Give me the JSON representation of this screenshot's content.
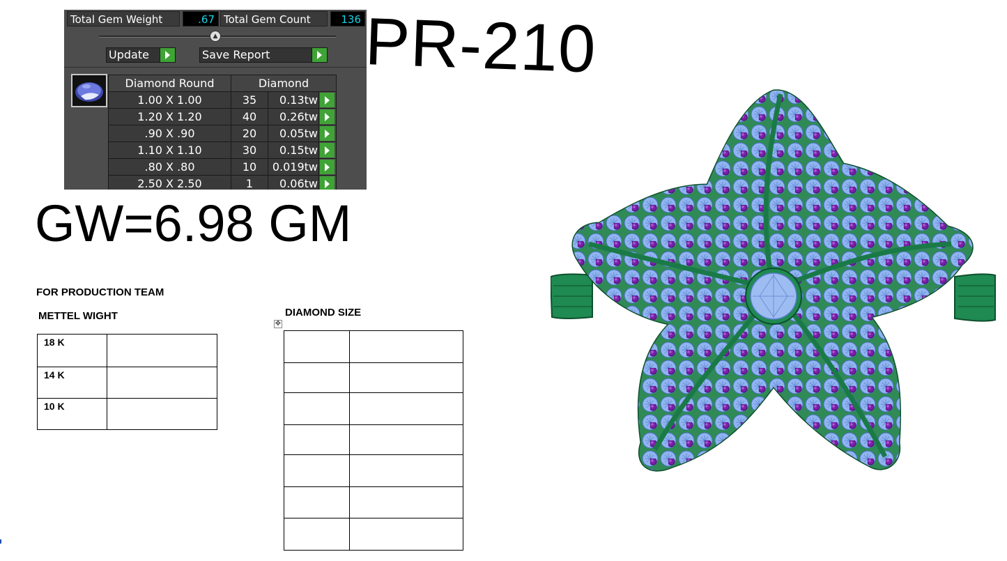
{
  "panel": {
    "total_gem_weight_label": "Total Gem Weight",
    "total_gem_weight_value": ".67",
    "total_gem_count_label": "Total Gem Count",
    "total_gem_count_value": "136",
    "update_label": "Update",
    "save_report_label": "Save Report",
    "columns": [
      "Diamond Round",
      "Diamond"
    ],
    "rows": [
      {
        "size": "1.00 X 1.00",
        "count": "35",
        "tw": "0.13tw"
      },
      {
        "size": "1.20 X 1.20",
        "count": "40",
        "tw": "0.26tw"
      },
      {
        "size": ".90 X .90",
        "count": "20",
        "tw": "0.05tw"
      },
      {
        "size": "1.10 X 1.10",
        "count": "30",
        "tw": "0.15tw"
      },
      {
        "size": ".80 X .80",
        "count": "10",
        "tw": "0.019tw"
      },
      {
        "size": "2.50 X 2.50",
        "count": "1",
        "tw": "0.06tw"
      }
    ]
  },
  "product_code": "PR-210",
  "gross_weight": "GW=6.98 GM",
  "production": {
    "heading": "FOR PRODUCTION TEAM",
    "metal_heading": "METTEL WIGHT",
    "metal_rows": [
      "18 K",
      "14 K",
      "10 K"
    ],
    "diamond_heading": "DIAMOND SIZE"
  },
  "colors": {
    "panel_bg": "#4d4d4d",
    "value_text": "#19d3e6",
    "go_button": "#3fa336",
    "ring_metal": "#1f8a52",
    "stone_blue": "#8fb4f0",
    "stone_purple": "#7a1fa8"
  }
}
